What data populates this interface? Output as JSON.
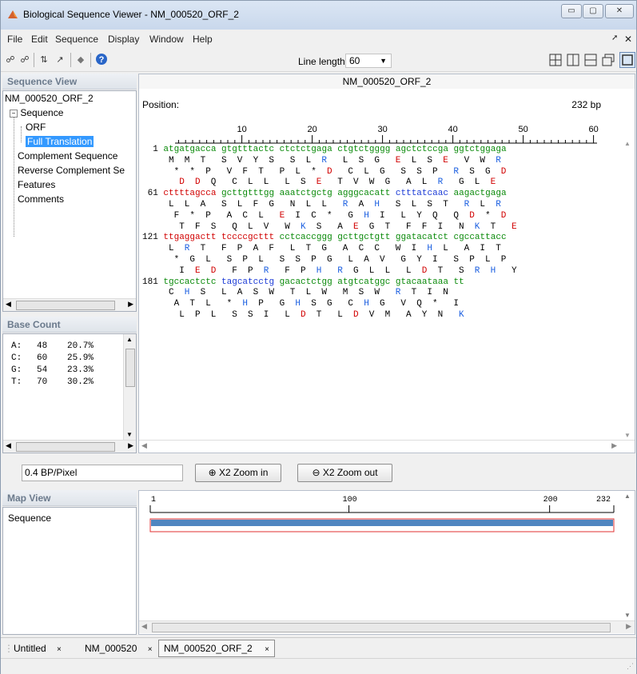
{
  "window": {
    "title": "Biological Sequence Viewer - NM_000520_ORF_2"
  },
  "menu": [
    "File",
    "Edit",
    "Sequence",
    "Display",
    "Window",
    "Help"
  ],
  "toolbar": {
    "line_length_label": "Line length:",
    "line_length_value": "60"
  },
  "sequence_view": {
    "header": "Sequence View",
    "tree": {
      "root": "NM_000520_ORF_2",
      "sequence": "Sequence",
      "orf": "ORF",
      "full_translation": "Full Translation",
      "complement": "Complement Sequence",
      "reverse_complement": "Reverse Complement Se",
      "features": "Features",
      "comments": "Comments"
    }
  },
  "main": {
    "title": "NM_000520_ORF_2",
    "position_label": "Position:",
    "length": "232 bp",
    "ruler": [
      "10",
      "20",
      "30",
      "40",
      "50",
      "60"
    ],
    "blocks": [
      {
        "num": "1",
        "seq": [
          [
            "atgatgacca",
            "g"
          ],
          [
            "gtgtttactc",
            "g"
          ],
          [
            "ctctctgaga",
            "g"
          ],
          [
            "ctgtctgggg",
            "g"
          ],
          [
            "agctctccga",
            "g"
          ],
          [
            "ggtctggaga",
            "g"
          ]
        ],
        "frames": [
          [
            [
              "M",
              "k"
            ],
            [
              "M",
              "k"
            ],
            [
              "T",
              "k"
            ],
            [
              "S",
              "k"
            ],
            [
              "V",
              "k"
            ],
            [
              "Y",
              "k"
            ],
            [
              "S",
              "k"
            ],
            [
              "S",
              "k"
            ],
            [
              "L",
              "k"
            ],
            [
              "R",
              "b"
            ],
            [
              "L",
              "k"
            ],
            [
              "S",
              "k"
            ],
            [
              "G",
              "k"
            ],
            [
              "E",
              "r"
            ],
            [
              "L",
              "k"
            ],
            [
              "S",
              "k"
            ],
            [
              "E",
              "r"
            ],
            [
              "V",
              "k"
            ],
            [
              "W",
              "k"
            ],
            [
              "R",
              "b"
            ]
          ],
          [
            [
              "*",
              "k"
            ],
            [
              "*",
              "k"
            ],
            [
              "P",
              "k"
            ],
            [
              "V",
              "k"
            ],
            [
              "F",
              "k"
            ],
            [
              "T",
              "k"
            ],
            [
              "P",
              "k"
            ],
            [
              "L",
              "k"
            ],
            [
              "*",
              "k"
            ],
            [
              "D",
              "r"
            ],
            [
              "C",
              "k"
            ],
            [
              "L",
              "k"
            ],
            [
              "G",
              "k"
            ],
            [
              "S",
              "k"
            ],
            [
              "S",
              "k"
            ],
            [
              "P",
              "k"
            ],
            [
              "R",
              "b"
            ],
            [
              "S",
              "k"
            ],
            [
              "G",
              "k"
            ],
            [
              "D",
              "r"
            ]
          ],
          [
            [
              "D",
              "r"
            ],
            [
              "D",
              "r"
            ],
            [
              "Q",
              "k"
            ],
            [
              "C",
              "k"
            ],
            [
              "L",
              "k"
            ],
            [
              "L",
              "k"
            ],
            [
              "L",
              "k"
            ],
            [
              "S",
              "k"
            ],
            [
              "E",
              "r"
            ],
            [
              "T",
              "k"
            ],
            [
              "V",
              "k"
            ],
            [
              "W",
              "k"
            ],
            [
              "G",
              "k"
            ],
            [
              "A",
              "k"
            ],
            [
              "L",
              "k"
            ],
            [
              "R",
              "b"
            ],
            [
              "G",
              "k"
            ],
            [
              "L",
              "k"
            ],
            [
              "E",
              "r"
            ]
          ]
        ]
      },
      {
        "num": "61",
        "seq": [
          [
            "cttttagcca",
            "r"
          ],
          [
            "gcttgtttgg",
            "g"
          ],
          [
            "aaatctgctg",
            "g"
          ],
          [
            "agggcacatt",
            "g"
          ],
          [
            "ctttatcaac",
            "b"
          ],
          [
            "aagactgaga",
            "g"
          ]
        ],
        "frames": [
          [
            [
              "L",
              "k"
            ],
            [
              "L",
              "k"
            ],
            [
              "A",
              "k"
            ],
            [
              "S",
              "k"
            ],
            [
              "L",
              "k"
            ],
            [
              "F",
              "k"
            ],
            [
              "G",
              "k"
            ],
            [
              "N",
              "k"
            ],
            [
              "L",
              "k"
            ],
            [
              "L",
              "k"
            ],
            [
              "R",
              "b"
            ],
            [
              "A",
              "k"
            ],
            [
              "H",
              "b"
            ],
            [
              "S",
              "k"
            ],
            [
              "L",
              "k"
            ],
            [
              "S",
              "k"
            ],
            [
              "T",
              "k"
            ],
            [
              "R",
              "b"
            ],
            [
              "L",
              "k"
            ],
            [
              "R",
              "b"
            ]
          ],
          [
            [
              "F",
              "k"
            ],
            [
              "*",
              "k"
            ],
            [
              "P",
              "k"
            ],
            [
              "A",
              "k"
            ],
            [
              "C",
              "k"
            ],
            [
              "L",
              "k"
            ],
            [
              "E",
              "r"
            ],
            [
              "I",
              "k"
            ],
            [
              "C",
              "k"
            ],
            [
              "*",
              "k"
            ],
            [
              "G",
              "k"
            ],
            [
              "H",
              "b"
            ],
            [
              "I",
              "k"
            ],
            [
              "L",
              "k"
            ],
            [
              "Y",
              "k"
            ],
            [
              "Q",
              "k"
            ],
            [
              "Q",
              "k"
            ],
            [
              "D",
              "r"
            ],
            [
              "*",
              "k"
            ],
            [
              "D",
              "r"
            ]
          ],
          [
            [
              "T",
              "k"
            ],
            [
              "F",
              "k"
            ],
            [
              "S",
              "k"
            ],
            [
              "Q",
              "k"
            ],
            [
              "L",
              "k"
            ],
            [
              "V",
              "k"
            ],
            [
              "W",
              "k"
            ],
            [
              "K",
              "b"
            ],
            [
              "S",
              "k"
            ],
            [
              "A",
              "k"
            ],
            [
              "E",
              "r"
            ],
            [
              "G",
              "k"
            ],
            [
              "T",
              "k"
            ],
            [
              "F",
              "k"
            ],
            [
              "F",
              "k"
            ],
            [
              "I",
              "k"
            ],
            [
              "N",
              "k"
            ],
            [
              "K",
              "b"
            ],
            [
              "T",
              "k"
            ],
            [
              "E",
              "r"
            ]
          ]
        ]
      },
      {
        "num": "121",
        "seq": [
          [
            "ttgaggactt",
            "r"
          ],
          [
            "tccccgcttt",
            "r"
          ],
          [
            "cctcaccggg",
            "g"
          ],
          [
            "gcttgctgtt",
            "g"
          ],
          [
            "ggatacatct",
            "g"
          ],
          [
            "cgccattacc",
            "g"
          ]
        ],
        "frames": [
          [
            [
              "L",
              "k"
            ],
            [
              "R",
              "b"
            ],
            [
              "T",
              "k"
            ],
            [
              "F",
              "k"
            ],
            [
              "P",
              "k"
            ],
            [
              "A",
              "k"
            ],
            [
              "F",
              "k"
            ],
            [
              "L",
              "k"
            ],
            [
              "T",
              "k"
            ],
            [
              "G",
              "k"
            ],
            [
              "A",
              "k"
            ],
            [
              "C",
              "k"
            ],
            [
              "C",
              "k"
            ],
            [
              "W",
              "k"
            ],
            [
              "I",
              "k"
            ],
            [
              "H",
              "b"
            ],
            [
              "L",
              "k"
            ],
            [
              "A",
              "k"
            ],
            [
              "I",
              "k"
            ],
            [
              "T",
              "k"
            ]
          ],
          [
            [
              "*",
              "k"
            ],
            [
              "G",
              "k"
            ],
            [
              "L",
              "k"
            ],
            [
              "S",
              "k"
            ],
            [
              "P",
              "k"
            ],
            [
              "L",
              "k"
            ],
            [
              "S",
              "k"
            ],
            [
              "S",
              "k"
            ],
            [
              "P",
              "k"
            ],
            [
              "G",
              "k"
            ],
            [
              "L",
              "k"
            ],
            [
              "A",
              "k"
            ],
            [
              "V",
              "k"
            ],
            [
              "G",
              "k"
            ],
            [
              "Y",
              "k"
            ],
            [
              "I",
              "k"
            ],
            [
              "S",
              "k"
            ],
            [
              "P",
              "k"
            ],
            [
              "L",
              "k"
            ],
            [
              "P",
              "k"
            ]
          ],
          [
            [
              "I",
              "k"
            ],
            [
              "E",
              "r"
            ],
            [
              "D",
              "r"
            ],
            [
              "F",
              "k"
            ],
            [
              "P",
              "k"
            ],
            [
              "R",
              "b"
            ],
            [
              "F",
              "k"
            ],
            [
              "P",
              "k"
            ],
            [
              "H",
              "b"
            ],
            [
              "R",
              "b"
            ],
            [
              "G",
              "k"
            ],
            [
              "L",
              "k"
            ],
            [
              "L",
              "k"
            ],
            [
              "L",
              "k"
            ],
            [
              "D",
              "r"
            ],
            [
              "T",
              "k"
            ],
            [
              "S",
              "k"
            ],
            [
              "R",
              "b"
            ],
            [
              "H",
              "b"
            ],
            [
              "Y",
              "k"
            ]
          ]
        ]
      },
      {
        "num": "181",
        "seq": [
          [
            "tgccactctc",
            "g"
          ],
          [
            "tagcatcctg",
            "b"
          ],
          [
            "gacactctgg",
            "g"
          ],
          [
            "atgtcatggc",
            "g"
          ],
          [
            "gtacaataaa",
            "g"
          ],
          [
            "tt",
            "g"
          ]
        ],
        "frames": [
          [
            [
              "C",
              "k"
            ],
            [
              "H",
              "b"
            ],
            [
              "S",
              "k"
            ],
            [
              "L",
              "k"
            ],
            [
              "A",
              "k"
            ],
            [
              "S",
              "k"
            ],
            [
              "W",
              "k"
            ],
            [
              "T",
              "k"
            ],
            [
              "L",
              "k"
            ],
            [
              "W",
              "k"
            ],
            [
              "M",
              "k"
            ],
            [
              "S",
              "k"
            ],
            [
              "W",
              "k"
            ],
            [
              "R",
              "b"
            ],
            [
              "T",
              "k"
            ],
            [
              "I",
              "k"
            ],
            [
              "N",
              "k"
            ]
          ],
          [
            [
              "A",
              "k"
            ],
            [
              "T",
              "k"
            ],
            [
              "L",
              "k"
            ],
            [
              "*",
              "k"
            ],
            [
              "H",
              "b"
            ],
            [
              "P",
              "k"
            ],
            [
              "G",
              "k"
            ],
            [
              "H",
              "b"
            ],
            [
              "S",
              "k"
            ],
            [
              "G",
              "k"
            ],
            [
              "C",
              "k"
            ],
            [
              "H",
              "b"
            ],
            [
              "G",
              "k"
            ],
            [
              "V",
              "k"
            ],
            [
              "Q",
              "k"
            ],
            [
              "*",
              "k"
            ],
            [
              "I",
              "k"
            ]
          ],
          [
            [
              "L",
              "k"
            ],
            [
              "P",
              "k"
            ],
            [
              "L",
              "k"
            ],
            [
              "S",
              "k"
            ],
            [
              "S",
              "k"
            ],
            [
              "I",
              "k"
            ],
            [
              "L",
              "k"
            ],
            [
              "D",
              "r"
            ],
            [
              "T",
              "k"
            ],
            [
              "L",
              "k"
            ],
            [
              "D",
              "r"
            ],
            [
              "V",
              "k"
            ],
            [
              "M",
              "k"
            ],
            [
              "A",
              "k"
            ],
            [
              "Y",
              "k"
            ],
            [
              "N",
              "k"
            ],
            [
              "K",
              "b"
            ]
          ]
        ]
      }
    ]
  },
  "base_count": {
    "header": "Base Count",
    "rows": [
      {
        "base": "A:",
        "count": "48",
        "pct": "20.7%"
      },
      {
        "base": "C:",
        "count": "60",
        "pct": "25.9%"
      },
      {
        "base": "G:",
        "count": "54",
        "pct": "23.3%"
      },
      {
        "base": "T:",
        "count": "70",
        "pct": "30.2%"
      }
    ]
  },
  "zoom": {
    "bp_per_pixel": "0.4 BP/Pixel",
    "zoom_in": "X2 Zoom in",
    "zoom_out": "X2 Zoom out"
  },
  "map_view": {
    "header": "Map View",
    "item": "Sequence",
    "ticks": [
      "1",
      "100",
      "200",
      "232"
    ],
    "total_bp": 232
  },
  "tabs": [
    {
      "label": "Untitled"
    },
    {
      "label": "NM_000520"
    },
    {
      "label": "NM_000520_ORF_2",
      "active": true
    }
  ],
  "colors": {
    "map_bar": "#4f86c0",
    "map_outline": "#e03030",
    "selection": "#3399ff"
  }
}
